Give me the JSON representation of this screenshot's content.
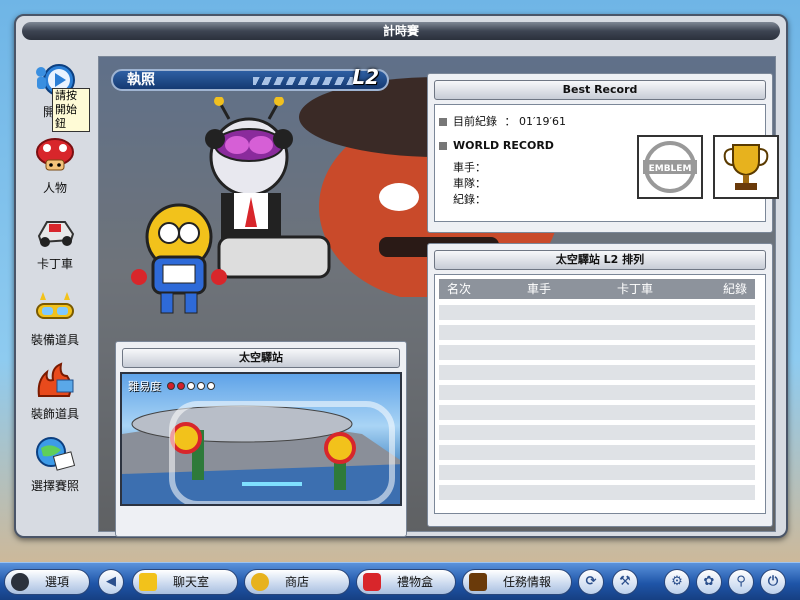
{
  "window": {
    "title": "計時賽"
  },
  "sidebar": {
    "tooltip": "請按開始鈕",
    "items": [
      {
        "label": "開始",
        "icon": "play-icon"
      },
      {
        "label": "人物",
        "icon": "character-icon"
      },
      {
        "label": "卡丁車",
        "icon": "kart-icon"
      },
      {
        "label": "裝備道具",
        "icon": "equipment-icon"
      },
      {
        "label": "裝飾道具",
        "icon": "decoration-icon"
      },
      {
        "label": "選擇賽照",
        "icon": "license-select-icon"
      }
    ]
  },
  "license": {
    "label": "執照",
    "level": "L2"
  },
  "best_record": {
    "header": "Best Record",
    "current_label": "目前紀錄",
    "current_value": "：  01′19′61",
    "world_label": "WORLD RECORD",
    "driver_label": "車手：",
    "team_label": "車隊：",
    "record_label": "紀錄：",
    "emblem_text": "EMBLEM"
  },
  "ranking": {
    "header": "太空驛站 L2 排列",
    "columns": [
      "名次",
      "車手",
      "卡丁車",
      "紀錄"
    ],
    "row_count": 10
  },
  "track": {
    "name": "太空驛站",
    "difficulty_label": "難易度",
    "difficulty": 2,
    "difficulty_max": 5
  },
  "taskbar": {
    "options_label": "選項",
    "chat_label": "聊天室",
    "shop_label": "商店",
    "gift_label": "禮物盒",
    "quest_label": "任務情報"
  },
  "colors": {
    "accent": "#1f55a8",
    "difficulty_on": "#d21f2a",
    "difficulty_off": "#ffffff"
  }
}
